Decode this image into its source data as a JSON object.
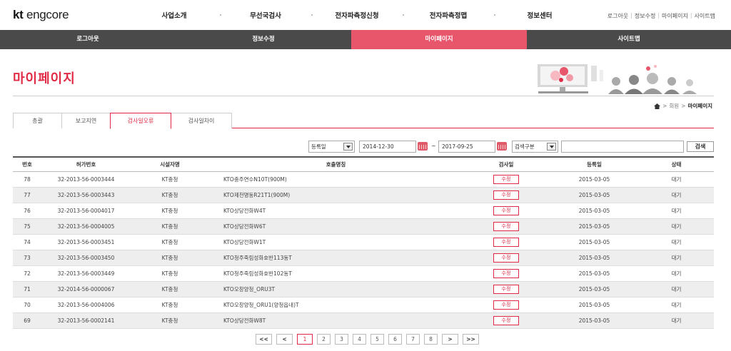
{
  "header": {
    "logo_kt": "kt",
    "logo_text": "engcore",
    "gnb": [
      "사업소개",
      "무선국검사",
      "전자파측정신청",
      "전자파측정맵",
      "정보센터"
    ],
    "util": [
      "로그아웃",
      "정보수정",
      "마이페이지",
      "사이트맵"
    ]
  },
  "subnav": [
    "로그아웃",
    "정보수정",
    "마이페이지",
    "사이트맵"
  ],
  "page": {
    "title": "마이페이지",
    "breadcrumb_home": "회원",
    "breadcrumb_current": "마이페이지"
  },
  "tabs": [
    "총괄",
    "보고지연",
    "검사일오류",
    "검사일차이"
  ],
  "search": {
    "date_type": "등록일",
    "start_date": "2014-12-30",
    "range_sep": "~",
    "end_date": "2017-09-25",
    "search_type": "검색구분",
    "query": "",
    "button": "검색"
  },
  "table": {
    "headers": [
      "번호",
      "허가번호",
      "시설자명",
      "호출명칭",
      "검사일",
      "등록일",
      "상태"
    ],
    "rows": [
      {
        "no": "78",
        "permit": "32-2013-56-0003444",
        "facility": "KT충청",
        "call": "KTO충주연수N10T(900M)",
        "check": "수정",
        "reg": "2015-03-05",
        "status": "대기"
      },
      {
        "no": "77",
        "permit": "32-2013-56-0003443",
        "facility": "KT충청",
        "call": "KTO제천명동R21T1(900M)",
        "check": "수정",
        "reg": "2015-03-05",
        "status": "대기"
      },
      {
        "no": "76",
        "permit": "32-2013-56-0004017",
        "facility": "KT충청",
        "call": "KTO상당전화W4T",
        "check": "수정",
        "reg": "2015-03-05",
        "status": "대기"
      },
      {
        "no": "75",
        "permit": "32-2013-56-0004005",
        "facility": "KT충청",
        "call": "KTO상당전화W6T",
        "check": "수정",
        "reg": "2015-03-05",
        "status": "대기"
      },
      {
        "no": "74",
        "permit": "32-2013-56-0003451",
        "facility": "KT충청",
        "call": "KTO상당전화W1T",
        "check": "수정",
        "reg": "2015-03-05",
        "status": "대기"
      },
      {
        "no": "73",
        "permit": "32-2013-56-0003450",
        "facility": "KT충청",
        "call": "KTO청주죽림성화호반113동T",
        "check": "수정",
        "reg": "2015-03-05",
        "status": "대기"
      },
      {
        "no": "72",
        "permit": "32-2013-56-0003449",
        "facility": "KT충청",
        "call": "KTO청주죽림성화호반102동T",
        "check": "수정",
        "reg": "2015-03-05",
        "status": "대기"
      },
      {
        "no": "71",
        "permit": "32-2014-56-0000067",
        "facility": "KT충청",
        "call": "KTO오창양청_ORU3T",
        "check": "수정",
        "reg": "2015-03-05",
        "status": "대기"
      },
      {
        "no": "70",
        "permit": "32-2013-56-0004006",
        "facility": "KT충청",
        "call": "KTO오창양청_ORU1(양청읍내)T",
        "check": "수정",
        "reg": "2015-03-05",
        "status": "대기"
      },
      {
        "no": "69",
        "permit": "32-2013-56-0002141",
        "facility": "KT충청",
        "call": "KTO상당전화W8T",
        "check": "수정",
        "reg": "2015-03-05",
        "status": "대기"
      }
    ]
  },
  "pagination": {
    "first": "<<",
    "prev": "<",
    "pages": [
      "1",
      "2",
      "3",
      "4",
      "5",
      "6",
      "7",
      "8"
    ],
    "current": "1",
    "next": ">",
    "last": ">>"
  },
  "colors": {
    "accent": "#e02a46",
    "subnav_bg": "#4a4a4a",
    "subnav_active": "#e8566c"
  }
}
